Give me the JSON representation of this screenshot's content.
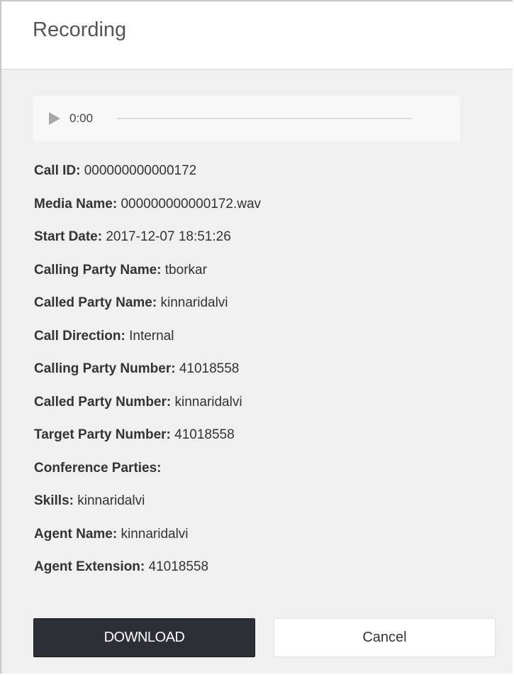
{
  "dialog": {
    "title": "Recording"
  },
  "player": {
    "time": "0:00",
    "progress": 0
  },
  "details": [
    {
      "label": "Call ID:",
      "value": "000000000000172"
    },
    {
      "label": "Media Name:",
      "value": "000000000000172.wav"
    },
    {
      "label": "Start Date:",
      "value": "2017-12-07 18:51:26"
    },
    {
      "label": "Calling Party Name:",
      "value": "tborkar"
    },
    {
      "label": "Called Party Name:",
      "value": "kinnaridalvi"
    },
    {
      "label": "Call Direction:",
      "value": "Internal"
    },
    {
      "label": "Calling Party Number:",
      "value": "41018558"
    },
    {
      "label": "Called Party Number:",
      "value": "kinnaridalvi"
    },
    {
      "label": "Target Party Number:",
      "value": "41018558"
    },
    {
      "label": "Conference Parties:",
      "value": ""
    },
    {
      "label": "Skills:",
      "value": "kinnaridalvi"
    },
    {
      "label": "Agent Name:",
      "value": "kinnaridalvi"
    },
    {
      "label": "Agent Extension:",
      "value": "41018558"
    }
  ],
  "buttons": {
    "download_label": "DOWNLOAD",
    "cancel_label": "Cancel"
  },
  "colors": {
    "primary_button": "#2c2f35",
    "dialog_body": "#f0f0f0"
  }
}
